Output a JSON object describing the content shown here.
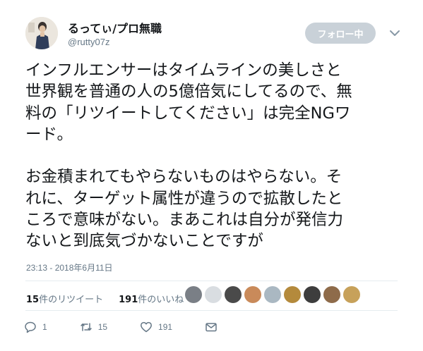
{
  "user": {
    "display_name": "るってぃ/プロ無職",
    "handle": "@rutty07z"
  },
  "follow_button": {
    "label": "フォロー中"
  },
  "tweet": {
    "lines": [
      "インフルエンサーはタイムラインの美しさと",
      "世界観を普通の人の5億倍気にしてるので、無",
      "料の「リツイートしてください」は完全NGワ",
      "ード。",
      "",
      "お金積まれてもやらないものはやらない。そ",
      "れに、ターゲット属性が違うので拡散したと",
      "ころで意味がない。まあこれは自分が発信力",
      "ないと到底気づかないことですが"
    ],
    "timestamp": "23:13 - 2018年6月11日"
  },
  "stats": {
    "retweets_count": "15",
    "retweets_label": "件のリツイート",
    "likes_count": "191",
    "likes_label": "件のいいね"
  },
  "actions": {
    "reply_count": "1",
    "retweet_count": "15",
    "like_count": "191"
  },
  "colors": {
    "follow_bg": "#c9d1d8",
    "secondary_text": "#657786",
    "divider": "#e6ecf0"
  }
}
